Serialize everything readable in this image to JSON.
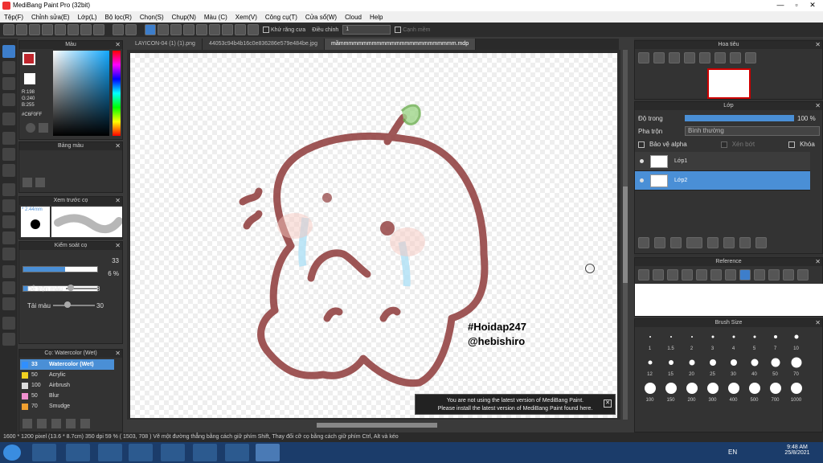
{
  "window": {
    "title": "MediBang Paint Pro (32bit)"
  },
  "menu": [
    "Tệp(F)",
    "Chỉnh sửa(E)",
    "Lớp(L)",
    "Bộ lọc(R)",
    "Chọn(S)",
    "Chụp(N)",
    "Màu (C)",
    "Xem(V)",
    "Công cụ(T)",
    "Cửa sổ(W)",
    "Cloud",
    "Help"
  ],
  "toolbar": {
    "antialias_label": "Khử răng cưa",
    "adjust_label": "Điều chỉnh",
    "adjust_value": "1",
    "edge_label": "Cạnh mềm"
  },
  "tabs": [
    "LAYICON-04 (1) (1).png",
    "44053c94b4b16c0e836286e579e484be.jpg",
    "mầmmmmmmmmmmmmmmmmmmmmmmmmm.mdp"
  ],
  "color_panel": {
    "title": "Màu",
    "r": "R:198",
    "g": "G:240",
    "b": "B:255",
    "hex": "#C6F0FF"
  },
  "palette_panel": {
    "title": "Bảng màu"
  },
  "preview_panel": {
    "title": "Xem trước cọ",
    "size": "2.44mm"
  },
  "brush_control": {
    "title": "Kiểm soát cọ",
    "size_value": "33",
    "opacity_value": "6 %",
    "size_fraction": 0.56,
    "opacity_fraction": 0.06,
    "blend_label": "Dễ trộn màu",
    "blend_value": "8",
    "refill_label": "Tải màu",
    "refill_value": "30"
  },
  "brush_list": {
    "title": "Cọ: Watercolor (Wet)",
    "items": [
      {
        "size": "33",
        "name": "Watercolor (Wet)",
        "color": "#2f8fff"
      },
      {
        "size": "50",
        "name": "Acrylic",
        "color": "#f0d020"
      },
      {
        "size": "100",
        "name": "Airbrush",
        "color": "#dddddd"
      },
      {
        "size": "50",
        "name": "Blur",
        "color": "#f090d0"
      },
      {
        "size": "70",
        "name": "Smudge",
        "color": "#f0a030"
      }
    ]
  },
  "canvas": {
    "hashtag": "#Hoidap247",
    "handle": "@hebishiro"
  },
  "notice": {
    "line1": "You are not using the latest version of MediBang Paint.",
    "line2": "Please install the latest version of MediBang Paint found here."
  },
  "status": "1600 * 1200 pixel  (13.6 * 8.7cm)  350 dpi  59 %  ( 1503, 708 )  Vẽ một đường thẳng bằng cách giữ phím Shift, Thay đổi cỡ cọ bằng cách giữ phím Ctrl, Alt và kéo",
  "navigator": {
    "title": "Hoa tiêu"
  },
  "layer_panel": {
    "title": "Lớp",
    "opacity_label": "Độ trong",
    "opacity_value": "100 %",
    "blend_label": "Pha trộn",
    "blend_value": "Bình thường",
    "protect_alpha": "Bảo vệ alpha",
    "clipping": "Xén bớt",
    "lock": "Khóa",
    "layers": [
      {
        "name": "Lớp1",
        "selected": false
      },
      {
        "name": "Lớp2",
        "selected": true
      }
    ]
  },
  "reference_panel": {
    "title": "Reference"
  },
  "brush_size_panel": {
    "title": "Brush Size",
    "sizes": [
      "1",
      "1.5",
      "2",
      "3",
      "4",
      "5",
      "7",
      "10",
      "12",
      "15",
      "20",
      "25",
      "30",
      "40",
      "50",
      "70",
      "100",
      "150",
      "200",
      "300",
      "400",
      "500",
      "700",
      "1000"
    ]
  },
  "taskbar": {
    "lang": "EN",
    "time": "9:48 AM",
    "date": "25/8/2021"
  }
}
